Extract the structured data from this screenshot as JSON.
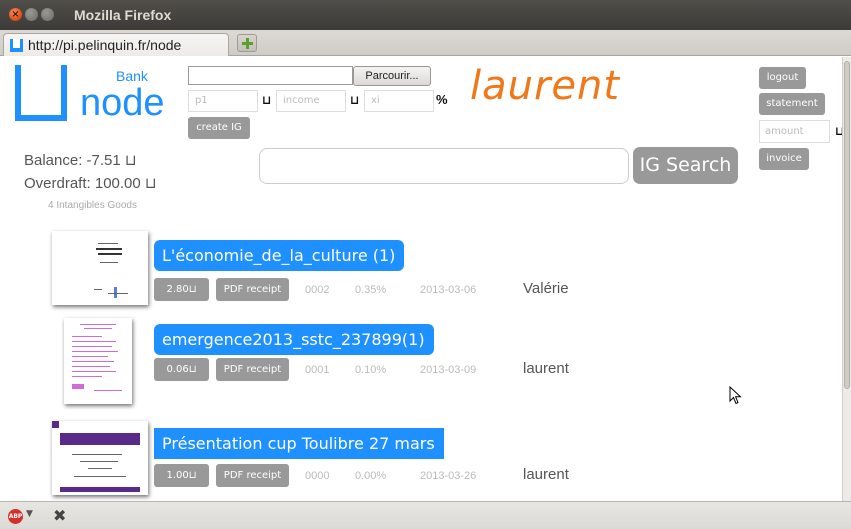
{
  "window": {
    "title": "Mozilla Firefox",
    "close_glyph": "×"
  },
  "tabs": [
    {
      "label": "http://pi.pelinquin.fr/node",
      "favicon": "node-u-icon"
    }
  ],
  "header": {
    "logo_bank": "Bank",
    "logo_node": "node",
    "browse_label": "Parcourir...",
    "p1_placeholder": "p1",
    "income_placeholder": "income",
    "xi_placeholder": "xi",
    "unit_symbol": "⊔",
    "percent_symbol": "%",
    "create_label": "create IG",
    "username": "laurent"
  },
  "right_panel": {
    "logout_label": "logout",
    "statement_label": "statement",
    "amount_placeholder": "amount",
    "amount_unit": "⊔",
    "invoice_label": "invoice"
  },
  "account": {
    "balance": "Balance: -7.51 ⊔",
    "overdraft": "Overdraft: 100.00 ⊔",
    "goods_count": "4 Intangibles Goods"
  },
  "search": {
    "value": "",
    "button_label": "IG Search"
  },
  "goods": [
    {
      "title": "L'économie_de_la_culture (1)",
      "price": "2.80⊔",
      "pdf_label": "PDF receipt",
      "code": "0002",
      "percent": "0.35%",
      "date": "2013-03-06",
      "owner": "Valérie"
    },
    {
      "title": "emergence2013_sstc_237899(1)",
      "price": "0.06⊔",
      "pdf_label": "PDF receipt",
      "code": "0001",
      "percent": "0.10%",
      "date": "2013-03-09",
      "owner": "laurent"
    },
    {
      "title": "Présentation cup Toulibre 27 mars",
      "price": "1.00⊔",
      "pdf_label": "PDF receipt",
      "code": "0000",
      "percent": "0.00%",
      "date": "2013-03-26",
      "owner": "laurent"
    }
  ],
  "statusbar": {
    "adblock_label": "ABP",
    "adblock_caret": "▼",
    "close_glyph": "✖"
  },
  "colors": {
    "accent": "#1e90ff",
    "username": "#f07818",
    "button_gray": "#999999"
  }
}
